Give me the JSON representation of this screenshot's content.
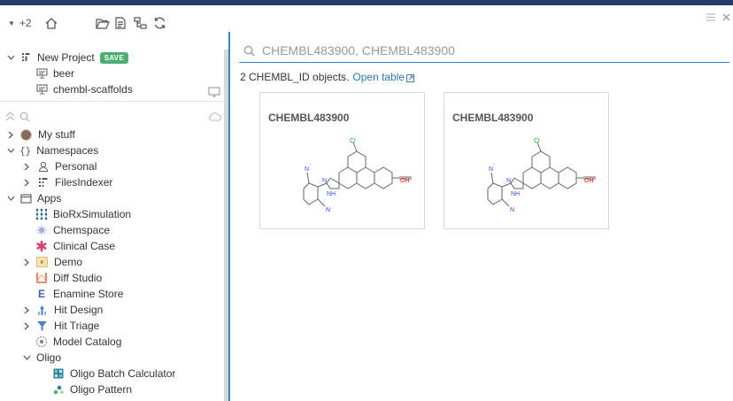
{
  "toolbar": {
    "expand_label": "+2"
  },
  "project": {
    "name": "New Project",
    "save_badge": "SAVE",
    "items": [
      {
        "label": "beer"
      },
      {
        "label": "chembl-scaffolds"
      }
    ]
  },
  "tree": {
    "my_stuff": "My stuff",
    "namespaces": "Namespaces",
    "namespace_items": [
      {
        "label": "Personal"
      },
      {
        "label": "FilesIndexer"
      }
    ],
    "apps": "Apps",
    "app_items": [
      {
        "label": "BioRxSimulation",
        "icon": "grid-dots-icon",
        "has_children": false
      },
      {
        "label": "Chemspace",
        "icon": "chemspace-icon",
        "has_children": false
      },
      {
        "label": "Clinical Case",
        "icon": "clinical-case-icon",
        "has_children": false
      },
      {
        "label": "Demo",
        "icon": "demo-icon",
        "has_children": true
      },
      {
        "label": "Diff Studio",
        "icon": "diff-studio-icon",
        "has_children": false
      },
      {
        "label": "Enamine Store",
        "icon": "enamine-icon",
        "has_children": false
      },
      {
        "label": "Hit Design",
        "icon": "hit-design-icon",
        "has_children": true
      },
      {
        "label": "Hit Triage",
        "icon": "hit-triage-icon",
        "has_children": true
      },
      {
        "label": "Model Catalog",
        "icon": "model-catalog-icon",
        "has_children": false
      },
      {
        "label": "Oligo",
        "icon": "",
        "has_children": true
      }
    ],
    "oligo_items": [
      {
        "label": "Oligo Batch Calculator"
      },
      {
        "label": "Oligo Pattern"
      }
    ]
  },
  "main": {
    "search_value": "CHEMBL483900, CHEMBL483900",
    "summary_text": "2 CHEMBL_ID objects.",
    "open_table_label": "Open table",
    "cards": [
      {
        "title": "CHEMBL483900",
        "atoms": {
          "cl": "Cl",
          "oh": "OH",
          "n1": "N",
          "n2": "N",
          "nh": "NH",
          "cn_top": "N",
          "cn_bottom": "N"
        }
      },
      {
        "title": "CHEMBL483900",
        "atoms": {
          "cl": "Cl",
          "oh": "OH",
          "n1": "N",
          "n2": "N",
          "nh": "NH",
          "cn_top": "N",
          "cn_bottom": "N"
        }
      }
    ]
  },
  "colors": {
    "accent": "#3b86c8",
    "top_strip": "#1f3d66",
    "save_badge": "#4caf70",
    "link": "#2a7ab8",
    "nitrogen": "#3050f8",
    "oxygen": "#ff0d0d",
    "chlorine": "#1ff01f"
  }
}
